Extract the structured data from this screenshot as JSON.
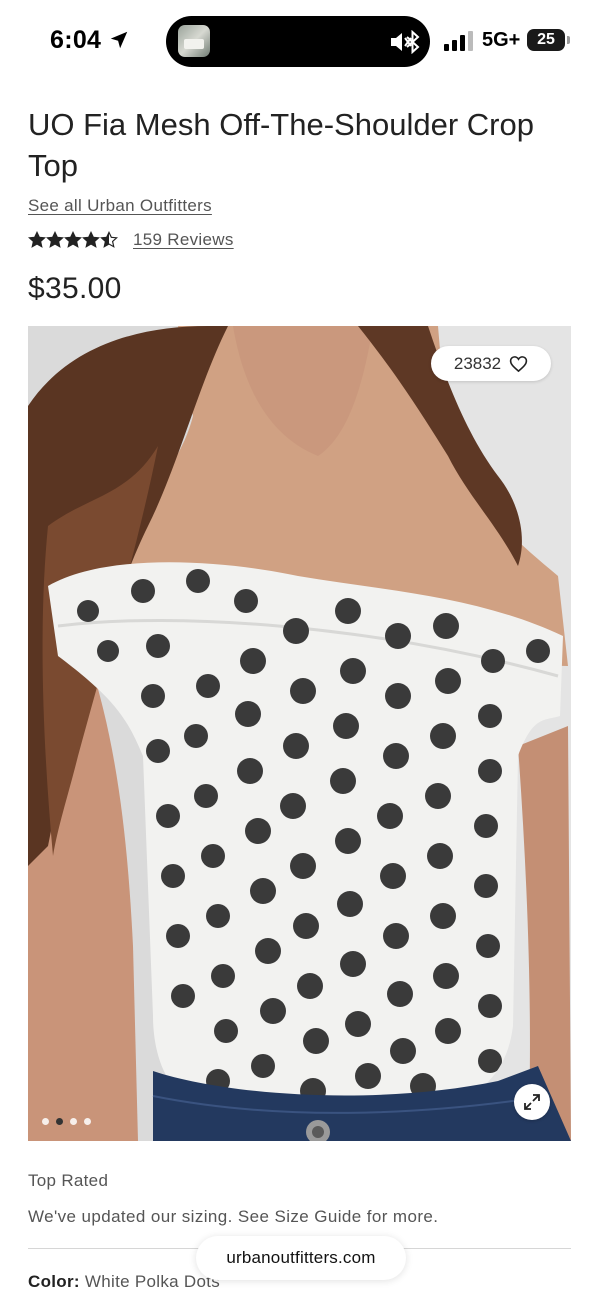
{
  "status_bar": {
    "time": "6:04",
    "network": "5G+",
    "battery": "25"
  },
  "product": {
    "title": "UO Fia Mesh Off-The-Shoulder Crop Top",
    "brand_link": "See all Urban Outfitters",
    "rating": 4.5,
    "reviews_link": "159 Reviews",
    "price": "$35.00",
    "likes_count": "23832",
    "carousel": {
      "total": 4,
      "active_index": 1
    },
    "badge": "Top Rated",
    "sizing_note": "We've updated our sizing. See Size Guide for more.",
    "color_label": "Color:",
    "color_value": "White Polka Dots"
  },
  "browser": {
    "url": "urbanoutfitters.com"
  },
  "icons": {
    "location": "location-arrow-icon",
    "mute": "bell-muted-icon",
    "bluetooth": "bluetooth-icon",
    "signal": "cellular-signal-icon",
    "heart": "heart-icon",
    "expand": "expand-icon",
    "star": "star-icon"
  }
}
